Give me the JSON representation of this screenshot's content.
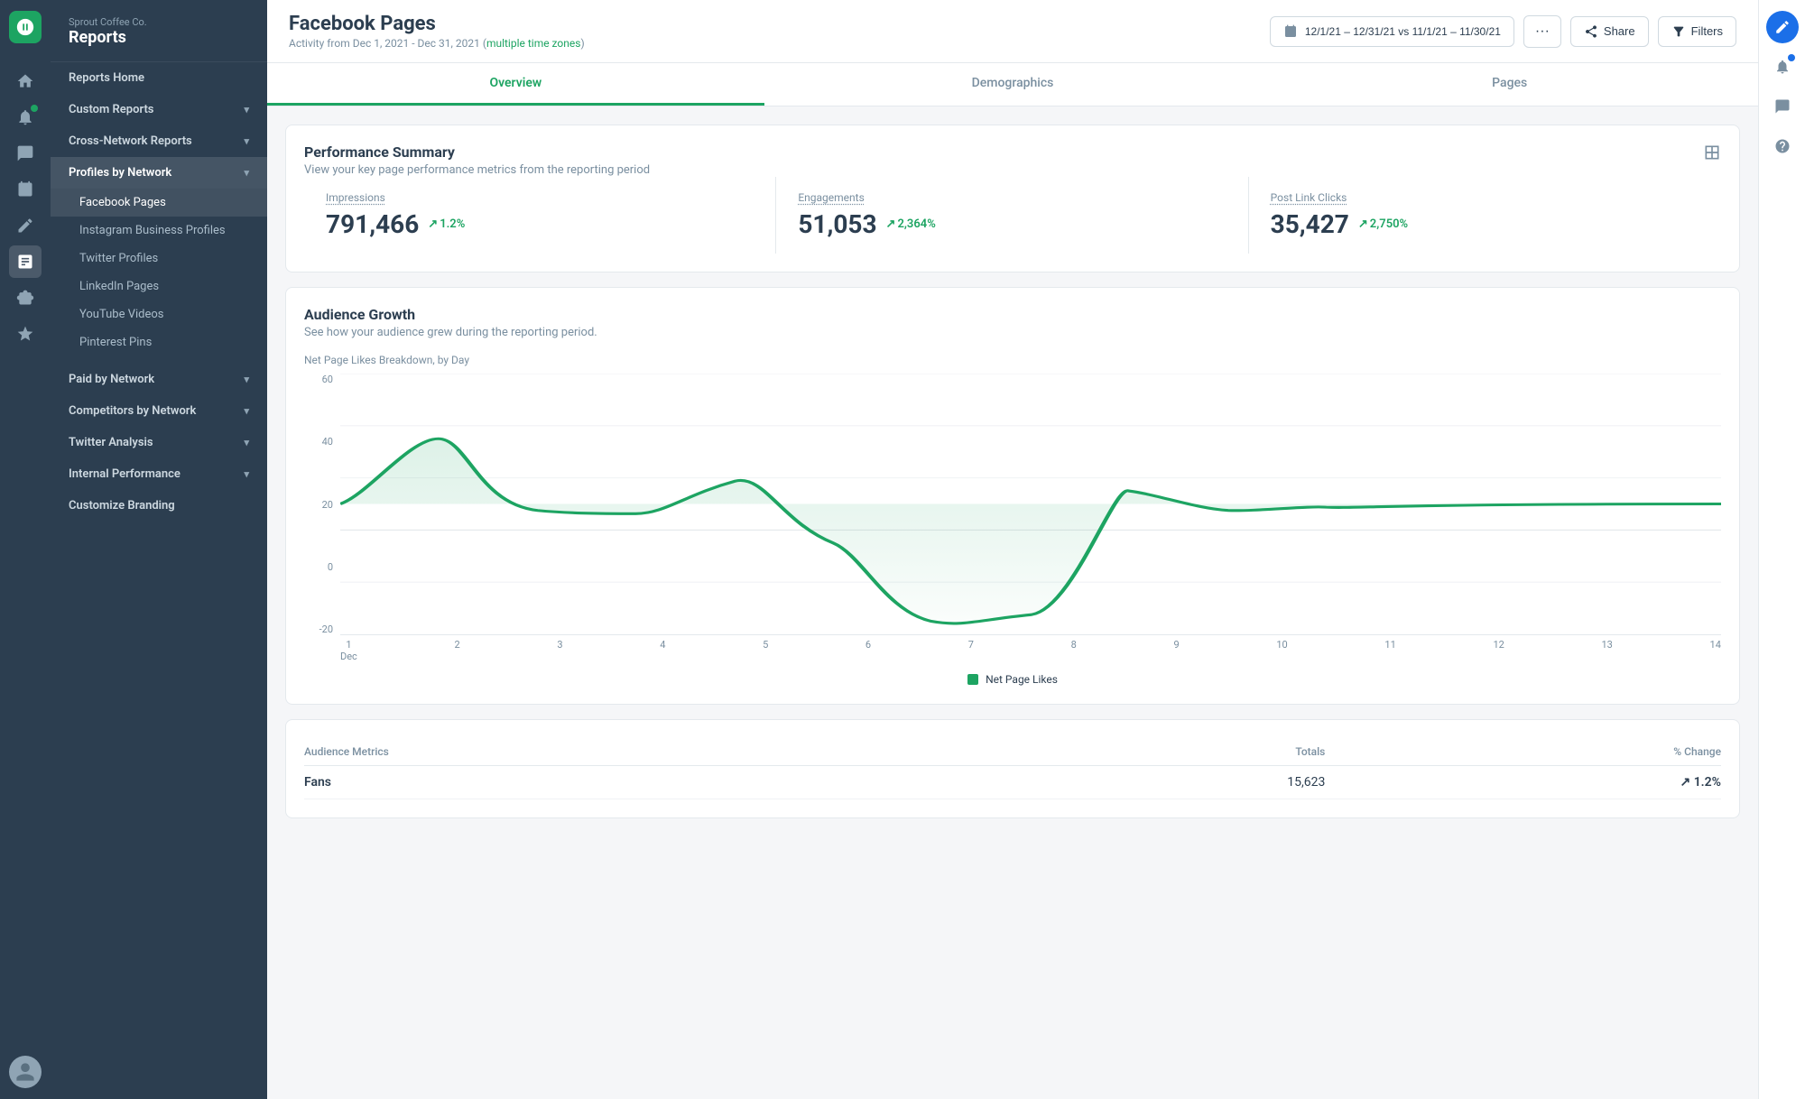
{
  "company": "Sprout Coffee Co.",
  "section": "Reports",
  "page": {
    "title": "Facebook Pages",
    "subtitle": "Activity from Dec 1, 2021 - Dec 31, 2021",
    "timezone_link": "multiple time zones",
    "date_range": "12/1/21 – 12/31/21 vs 11/1/21 – 11/30/21"
  },
  "tabs": [
    {
      "label": "Overview",
      "active": true
    },
    {
      "label": "Demographics",
      "active": false
    },
    {
      "label": "Pages",
      "active": false
    }
  ],
  "performance": {
    "title": "Performance Summary",
    "subtitle": "View your key page performance metrics from the reporting period",
    "metrics": [
      {
        "label": "Impressions",
        "value": "791,466",
        "change": "1.2%"
      },
      {
        "label": "Engagements",
        "value": "51,053",
        "change": "2,364%"
      },
      {
        "label": "Post Link Clicks",
        "value": "35,427",
        "change": "2,750%"
      }
    ]
  },
  "audience_growth": {
    "title": "Audience Growth",
    "subtitle": "See how your audience grew during the reporting period.",
    "chart_label": "Net Page Likes Breakdown, by Day",
    "y_labels": [
      "60",
      "40",
      "20",
      "0",
      "-20"
    ],
    "x_labels": [
      "1\nDec",
      "2",
      "3",
      "4",
      "5",
      "6",
      "7",
      "8",
      "9",
      "10",
      "11",
      "12",
      "13",
      "14"
    ],
    "legend": "Net Page Likes"
  },
  "audience_metrics": {
    "headers": [
      "",
      "Totals",
      "% Change"
    ],
    "rows": [
      {
        "label": "Fans",
        "total": "15,623",
        "change": "1.2%"
      }
    ]
  },
  "sidebar": {
    "items": [
      {
        "label": "Reports Home",
        "type": "item",
        "active": false
      },
      {
        "label": "Custom Reports",
        "type": "expandable",
        "active": false
      },
      {
        "label": "Cross-Network Reports",
        "type": "expandable",
        "active": false
      },
      {
        "label": "Profiles by Network",
        "type": "expandable",
        "active": true,
        "expanded": true
      },
      {
        "label": "Facebook Pages",
        "type": "sub",
        "active": true
      },
      {
        "label": "Instagram Business Profiles",
        "type": "sub",
        "active": false
      },
      {
        "label": "Twitter Profiles",
        "type": "sub",
        "active": false
      },
      {
        "label": "LinkedIn Pages",
        "type": "sub",
        "active": false
      },
      {
        "label": "YouTube Videos",
        "type": "sub",
        "active": false
      },
      {
        "label": "Pinterest Pins",
        "type": "sub",
        "active": false
      },
      {
        "label": "Paid by Network",
        "type": "expandable",
        "active": false
      },
      {
        "label": "Competitors by Network",
        "type": "expandable",
        "active": false
      },
      {
        "label": "Twitter Analysis",
        "type": "expandable",
        "active": false
      },
      {
        "label": "Internal Performance",
        "type": "expandable",
        "active": false
      },
      {
        "label": "Customize Branding",
        "type": "item",
        "active": false
      }
    ]
  }
}
